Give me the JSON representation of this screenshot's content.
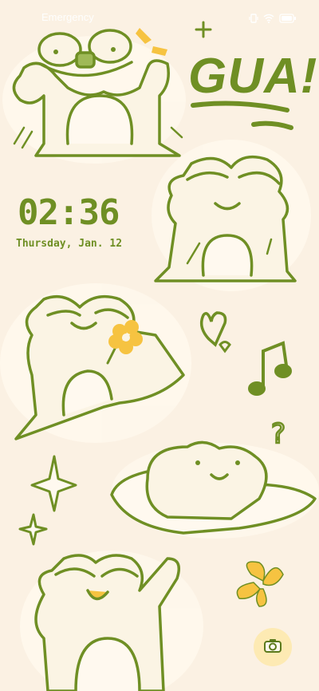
{
  "status_bar": {
    "carrier": "Emergency",
    "icons": [
      "vibrate-icon",
      "wifi-icon",
      "battery-icon"
    ]
  },
  "lock_screen": {
    "time": "02:36",
    "date": "Thursday, Jan. 12",
    "wallpaper_text": "GUA!"
  },
  "shortcuts": {
    "camera_icon": "camera-icon"
  },
  "colors": {
    "background": "#fbf1e3",
    "accent_green": "#6f8f24",
    "frog_fill": "#fbf4e4",
    "highlight_yellow": "#f6c341"
  }
}
